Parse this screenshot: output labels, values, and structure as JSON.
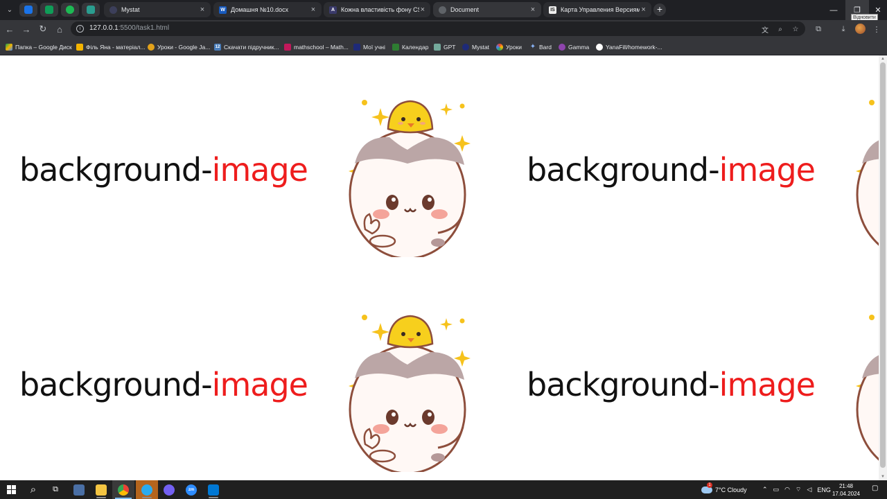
{
  "tabs": [
    {
      "title": "Mystat",
      "color": "#3c3f5a"
    },
    {
      "title": "Домашня №10.docx",
      "color": "#185abd"
    },
    {
      "title": "Кожна властивість фону CSS п",
      "color": "#3a3a6a"
    },
    {
      "title": "Document",
      "color": "#5f6368"
    },
    {
      "title": "Карта Управления Версиями -",
      "color": "#444"
    }
  ],
  "tooltip": "Відновити",
  "address": {
    "host": "127.0.0.1",
    "path": ":5500/task1.html"
  },
  "bookmarks": [
    "Папка – Google Диск",
    "Філь Яна - матеріал...",
    "Уроки - Google Ja...",
    "Скачати підручник...",
    "mathschool – Math...",
    "Мої учні",
    "Календар",
    "GPT",
    "Mystat",
    "Уроки",
    "Bard",
    "Gamma",
    "YanaFill/homework-..."
  ],
  "page": {
    "heading_black": "background-",
    "heading_red": "image"
  },
  "taskbar": {
    "weather": "7°C  Cloudy",
    "weather_badge": "1",
    "lang": "ENG",
    "time": "21:48",
    "date": "17.04.2024"
  }
}
